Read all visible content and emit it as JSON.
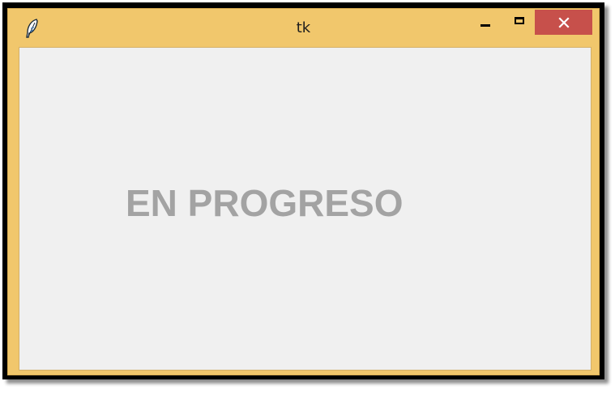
{
  "window": {
    "title": "tk",
    "app_icon": "feather-icon",
    "controls": {
      "minimize_icon": "minimize-icon",
      "maximize_icon": "maximize-icon",
      "close_icon": "close-icon"
    }
  },
  "content": {
    "status_text": "EN PROGRESO"
  },
  "colors": {
    "titlebar": "#f1c76c",
    "close_button": "#c7504b",
    "client_background": "#f0f0f0",
    "status_text": "#a3a3a3"
  }
}
